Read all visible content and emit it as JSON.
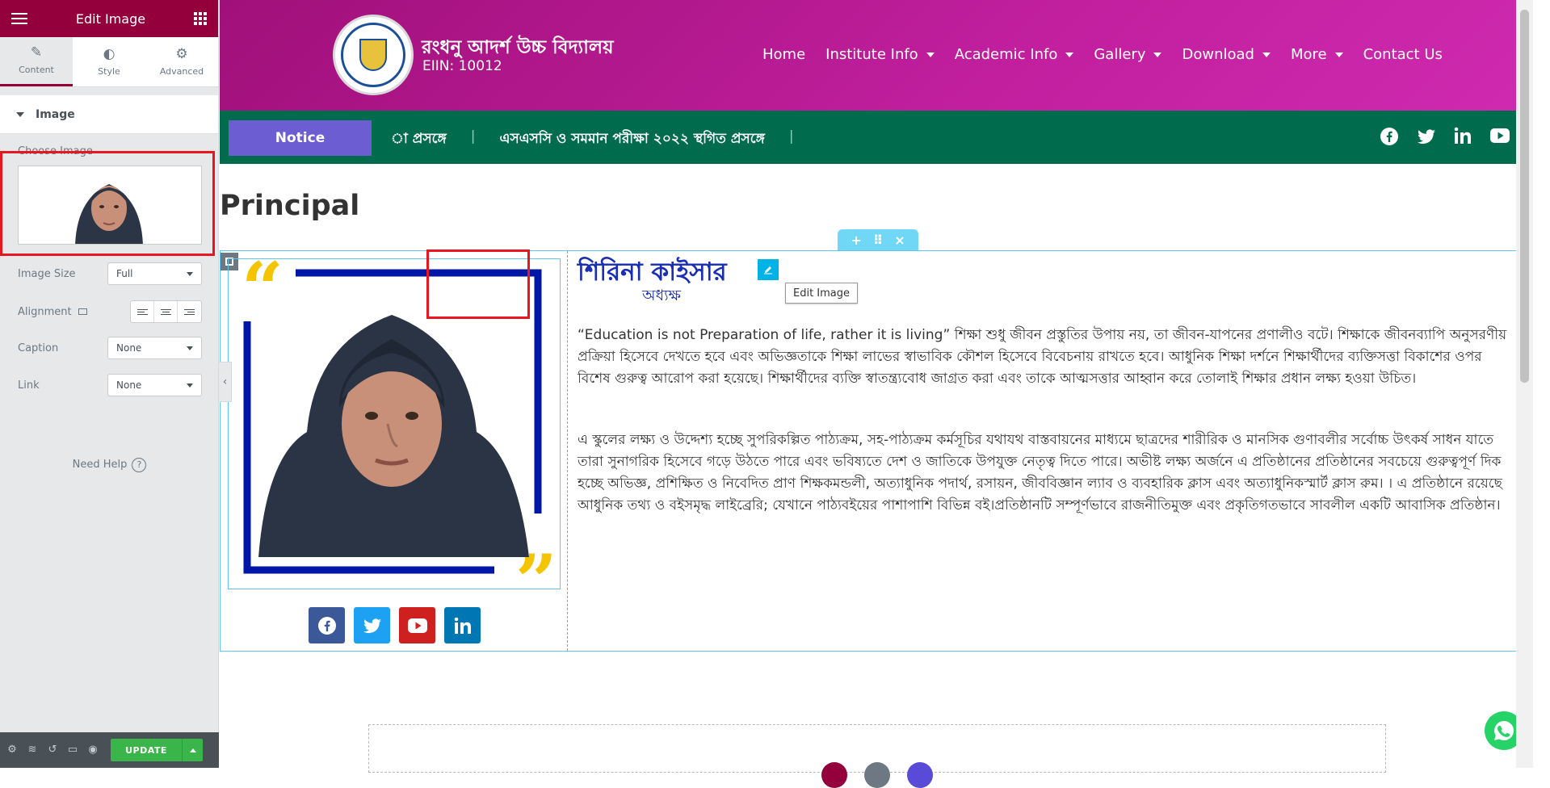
{
  "editor": {
    "title": "Edit Image",
    "tabs": [
      {
        "label": "Content",
        "icon": "pencil-icon",
        "active": true
      },
      {
        "label": "Style",
        "icon": "half-circle-icon",
        "active": false
      },
      {
        "label": "Advanced",
        "icon": "gear-icon",
        "active": false
      }
    ],
    "section_title": "Image",
    "choose_image_label": "Choose Image",
    "image_size": {
      "label": "Image Size",
      "value": "Full"
    },
    "alignment": {
      "label": "Alignment"
    },
    "caption": {
      "label": "Caption",
      "value": "None"
    },
    "link": {
      "label": "Link",
      "value": "None"
    },
    "need_help": "Need Help",
    "update_label": "UPDATE"
  },
  "site": {
    "school_name": "রংধনু আদর্শ উচ্চ বিদ্যালয়",
    "eiin": "EIIN: 10012",
    "nav": [
      {
        "label": "Home",
        "dropdown": false
      },
      {
        "label": "Institute Info",
        "dropdown": true
      },
      {
        "label": "Academic Info",
        "dropdown": true
      },
      {
        "label": "Gallery",
        "dropdown": true
      },
      {
        "label": "Download",
        "dropdown": true
      },
      {
        "label": "More",
        "dropdown": true
      },
      {
        "label": "Contact Us",
        "dropdown": false
      }
    ],
    "notice_label": "Notice",
    "ticker": [
      "া প্রসঙ্গে",
      "এসএসসি ও সমমান পরীক্ষা ২০২২ স্থগিত প্রসঙ্গে"
    ],
    "page_title": "Principal",
    "person_name": "শিরিনা কাইসার",
    "person_role": "অধ্যক্ষ",
    "edit_tooltip": "Edit Image",
    "paragraph1": "“Education is not Preparation of life, rather it is living” শিক্ষা শুধু জীবন প্রস্তুতির উপায় নয়, তা জীবন-যাপনের প্রণালীও বটে। শিক্ষাকে জীবনব্যাপি অনুসরণীয় প্রক্রিয়া হিসেবে দেখতে হবে এবং অভিজ্ঞতাকে শিক্ষা লাভের স্বাভাবিক কৌশল হিসেবে বিবেচনায় রাখতে হবে। আধুনিক শিক্ষা দর্শনে শিক্ষার্থীদের ব্যক্তিসত্তা বিকাশের ওপর বিশেষ গুরুত্ব আরোপ করা হয়েছে। শিক্ষার্থীদের ব্যক্তি স্বাতন্ত্র্যবোধ জাগ্রত করা এবং তাকে আত্মসত্তার আহ্বান করে তোলাই শিক্ষার প্রধান লক্ষ্য হওয়া উচিত।",
    "paragraph2": "এ স্কুলের লক্ষ্য ও উদ্দেশ্য হচ্ছে সুপরিকল্পিত পাঠ্যক্রম, সহ-পাঠ্যক্রম কর্মসূচির যথাযথ বাস্তবায়নের মাধ্যমে ছাত্রদের শারীরিক ও মানসিক গুণাবলীর সর্বোচ্চ উৎকর্ষ সাধন যাতে তারা সুনাগরিক হিসেবে গড়ে উঠতে পারে এবং ভবিষ্যতে দেশ ও জাতিকে উপযুক্ত নেতৃত্ব দিতে পারে। অভীষ্ট লক্ষ্য অর্জনে এ প্রতিষ্ঠানের প্রতিষ্ঠানের সবচেয়ে গুরুত্বপূর্ণ দিক হচ্ছে অভিজ্ঞ, প্রশিক্ষিত ও নিবেদিত প্রাণ শিক্ষকমন্ডলী, অত্যাধুনিক পদার্থ, রসায়ন, জীববিজ্ঞান ল্যাব ও ব্যবহারিক ক্লাস এবং অত্যাধুনিকস্মার্ট ক্লাস রুম। । এ প্রতিষ্ঠানে রয়েছে আধুনিক তথ্য ও বইসমৃদ্ধ লাইব্রেরি; যেখানে পাঠ্যবইয়ের পাশাপাশি বিভিন্ন বই।প্রতিষ্ঠানটি সম্পূর্ণভাবে রাজনীতিমুক্ত এবং প্রকৃতিগতভাবে সাবলীল একটি আবাসিক প্রতিষ্ঠান।",
    "social_top": [
      "facebook-icon",
      "twitter-icon",
      "linkedin-icon",
      "youtube-icon"
    ],
    "social_bottom": [
      {
        "icon": "facebook-icon",
        "color": "#3b5998"
      },
      {
        "icon": "twitter-icon",
        "color": "#1da1f2"
      },
      {
        "icon": "youtube-icon",
        "color": "#cd201f"
      },
      {
        "icon": "linkedin-icon",
        "color": "#0077b5"
      }
    ]
  },
  "colors": {
    "editor_accent": "#93003c",
    "header_gradient": "#c11f9e",
    "notice_bar": "#006c4d",
    "notice_button": "#6d5dd3",
    "heading_blue": "#1a2eb5",
    "quote_yellow": "#f5c400",
    "frame_blue": "#0016a6",
    "selection_red": "#e8161f",
    "update_green": "#39b54a"
  }
}
